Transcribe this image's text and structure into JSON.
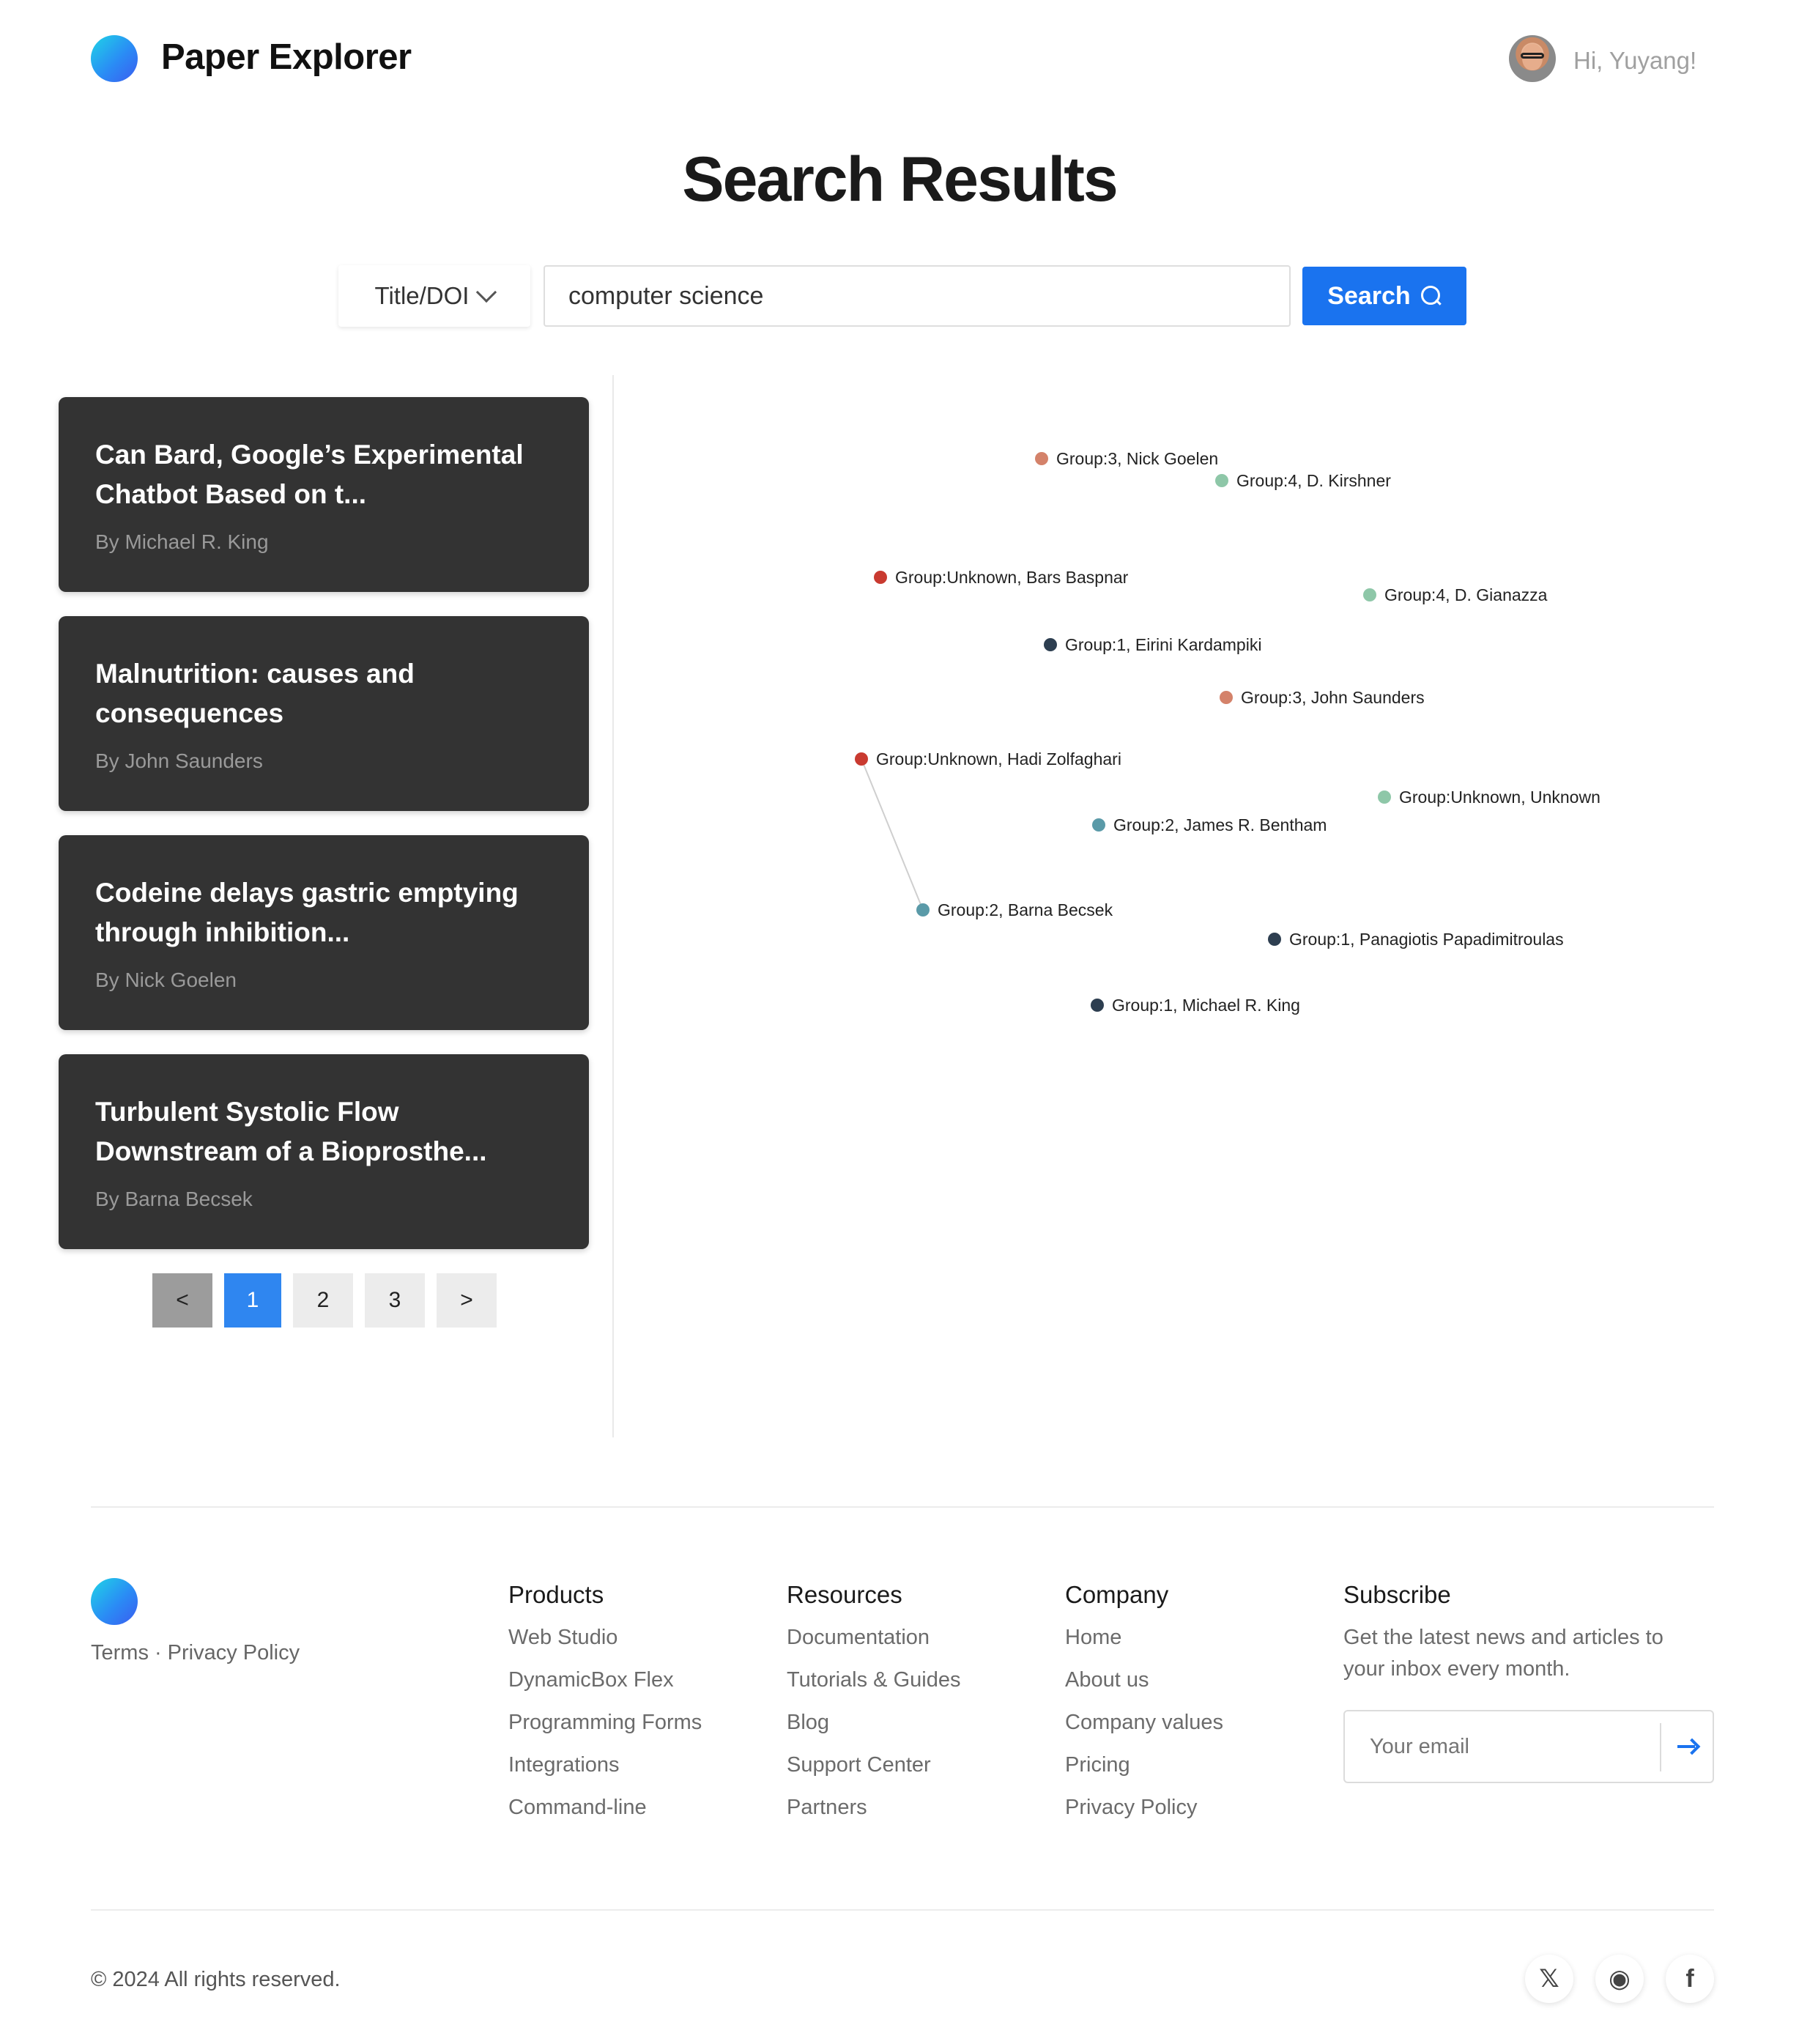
{
  "header": {
    "brand": "Paper Explorer",
    "greeting": "Hi, Yuyang!"
  },
  "page_title": "Search Results",
  "search": {
    "type_label": "Title/DOI",
    "query": "computer science",
    "button_label": "Search"
  },
  "results": [
    {
      "title": "Can Bard, Google’s Experimental Chatbot Based on t...",
      "author": "By Michael R. King"
    },
    {
      "title": "Malnutrition: causes and consequences",
      "author": "By John Saunders"
    },
    {
      "title": "Codeine delays gastric emptying through inhibition...",
      "author": "By Nick Goelen"
    },
    {
      "title": "Turbulent Systolic Flow Downstream of a Bioprosthe...",
      "author": "By Barna Becsek"
    }
  ],
  "pagination": {
    "prev": "<",
    "pages": [
      "1",
      "2",
      "3"
    ],
    "active": "1",
    "next": ">"
  },
  "graph": {
    "group_colors": {
      "Group:1": "#2d3e50",
      "Group:2": "#5a9aa8",
      "Group:3": "#d4826a",
      "Group:4": "#8ec7a8",
      "Group:Unknown": "#c93a30",
      "Group:Unknown-alt": "#8ec7a8"
    },
    "nodes": [
      {
        "label": "Group:3, Nick Goelen",
        "color": "#d4826a"
      },
      {
        "label": "Group:4, D. Kirshner",
        "color": "#8ec7a8"
      },
      {
        "label": "Group:Unknown, Bars Baspnar",
        "color": "#c93a30"
      },
      {
        "label": "Group:4, D. Gianazza",
        "color": "#8ec7a8"
      },
      {
        "label": "Group:1, Eirini Kardampiki",
        "color": "#2d3e50"
      },
      {
        "label": "Group:3, John Saunders",
        "color": "#d4826a"
      },
      {
        "label": "Group:Unknown, Hadi Zolfaghari",
        "color": "#c93a30"
      },
      {
        "label": "Group:Unknown, Unknown",
        "color": "#8ec7a8"
      },
      {
        "label": "Group:2, James R. Bentham",
        "color": "#5a9aa8"
      },
      {
        "label": "Group:2, Barna Becsek",
        "color": "#5a9aa8"
      },
      {
        "label": "Group:1, Panagiotis Papadimitroulas",
        "color": "#2d3e50"
      },
      {
        "label": "Group:1, Michael R. King",
        "color": "#2d3e50"
      }
    ],
    "edges": [
      {
        "from": "Group:Unknown, Hadi Zolfaghari",
        "to": "Group:2, Barna Becsek"
      }
    ]
  },
  "footer": {
    "legal": {
      "terms": "Terms",
      "separator": "·",
      "privacy": "Privacy Policy"
    },
    "columns": [
      {
        "heading": "Products",
        "items": [
          "Web Studio",
          "DynamicBox Flex",
          "Programming Forms",
          "Integrations",
          "Command-line"
        ]
      },
      {
        "heading": "Resources",
        "items": [
          "Documentation",
          "Tutorials & Guides",
          "Blog",
          "Support Center",
          "Partners"
        ]
      },
      {
        "heading": "Company",
        "items": [
          "Home",
          "About us",
          "Company values",
          "Pricing",
          "Privacy Policy"
        ]
      }
    ],
    "subscribe": {
      "heading": "Subscribe",
      "text": "Get the latest news and articles to your inbox every month.",
      "email_placeholder": "Your email"
    },
    "copyright": "© 2024 All rights reserved.",
    "social": [
      {
        "name": "x-icon",
        "glyph": "𝕏"
      },
      {
        "name": "github-icon",
        "glyph": "◉"
      },
      {
        "name": "facebook-icon",
        "glyph": "f"
      }
    ]
  }
}
